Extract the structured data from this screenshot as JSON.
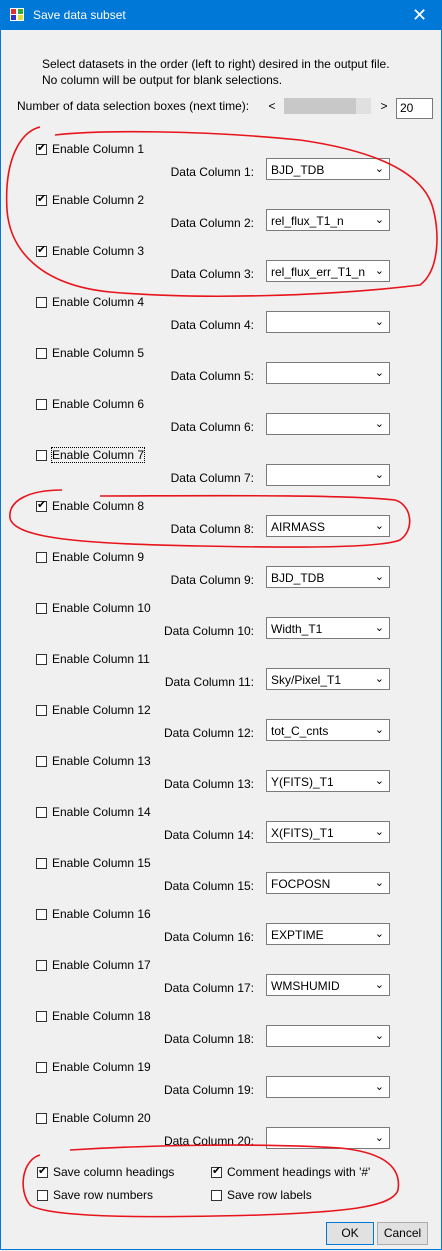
{
  "window": {
    "title": "Save data subset",
    "close_glyph": "✕"
  },
  "info": {
    "line1": "Select datasets in the order (left to right) desired in the output file.",
    "line2": "No column will be output for blank selections."
  },
  "boxes": {
    "label": "Number of data selection boxes (next time):",
    "value": "20",
    "left_arrow": "<",
    "right_arrow": ">"
  },
  "columns": [
    {
      "enable_label": "Enable Column 1",
      "checked": true,
      "dc_label": "Data Column 1:",
      "value": "BJD_TDB"
    },
    {
      "enable_label": "Enable Column 2",
      "checked": true,
      "dc_label": "Data Column 2:",
      "value": "rel_flux_T1_n"
    },
    {
      "enable_label": "Enable Column 3",
      "checked": true,
      "dc_label": "Data Column 3:",
      "value": "rel_flux_err_T1_n"
    },
    {
      "enable_label": "Enable Column 4",
      "checked": false,
      "dc_label": "Data Column 4:",
      "value": ""
    },
    {
      "enable_label": "Enable Column 5",
      "checked": false,
      "dc_label": "Data Column 5:",
      "value": ""
    },
    {
      "enable_label": "Enable Column 6",
      "checked": false,
      "dc_label": "Data Column 6:",
      "value": ""
    },
    {
      "enable_label": "Enable Column 7",
      "checked": false,
      "dc_label": "Data Column 7:",
      "value": ""
    },
    {
      "enable_label": "Enable Column 8",
      "checked": true,
      "dc_label": "Data Column 8:",
      "value": "AIRMASS"
    },
    {
      "enable_label": "Enable Column 9",
      "checked": false,
      "dc_label": "Data Column 9:",
      "value": "BJD_TDB"
    },
    {
      "enable_label": "Enable Column 10",
      "checked": false,
      "dc_label": "Data Column 10:",
      "value": "Width_T1"
    },
    {
      "enable_label": "Enable Column 11",
      "checked": false,
      "dc_label": "Data Column 11:",
      "value": "Sky/Pixel_T1"
    },
    {
      "enable_label": "Enable Column 12",
      "checked": false,
      "dc_label": "Data Column 12:",
      "value": "tot_C_cnts"
    },
    {
      "enable_label": "Enable Column 13",
      "checked": false,
      "dc_label": "Data Column 13:",
      "value": "Y(FITS)_T1"
    },
    {
      "enable_label": "Enable Column 14",
      "checked": false,
      "dc_label": "Data Column 14:",
      "value": "X(FITS)_T1"
    },
    {
      "enable_label": "Enable Column 15",
      "checked": false,
      "dc_label": "Data Column 15:",
      "value": "FOCPOSN"
    },
    {
      "enable_label": "Enable Column 16",
      "checked": false,
      "dc_label": "Data Column 16:",
      "value": "EXPTIME"
    },
    {
      "enable_label": "Enable Column 17",
      "checked": false,
      "dc_label": "Data Column 17:",
      "value": "WMSHUMID"
    },
    {
      "enable_label": "Enable Column 18",
      "checked": false,
      "dc_label": "Data Column 18:",
      "value": ""
    },
    {
      "enable_label": "Enable Column 19",
      "checked": false,
      "dc_label": "Data Column 19:",
      "value": ""
    },
    {
      "enable_label": "Enable Column 20",
      "checked": false,
      "dc_label": "Data Column 20:",
      "value": ""
    }
  ],
  "options": {
    "save_headings": {
      "label": "Save column headings",
      "checked": true
    },
    "comment_headings": {
      "label": "Comment headings with '#'",
      "checked": true
    },
    "save_row_numbers": {
      "label": "Save row numbers",
      "checked": false
    },
    "save_row_labels": {
      "label": "Save row labels",
      "checked": false
    }
  },
  "buttons": {
    "ok": "OK",
    "cancel": "Cancel"
  },
  "colors": {
    "titlebar": "#0078d7",
    "annotation": "#e8141c"
  }
}
